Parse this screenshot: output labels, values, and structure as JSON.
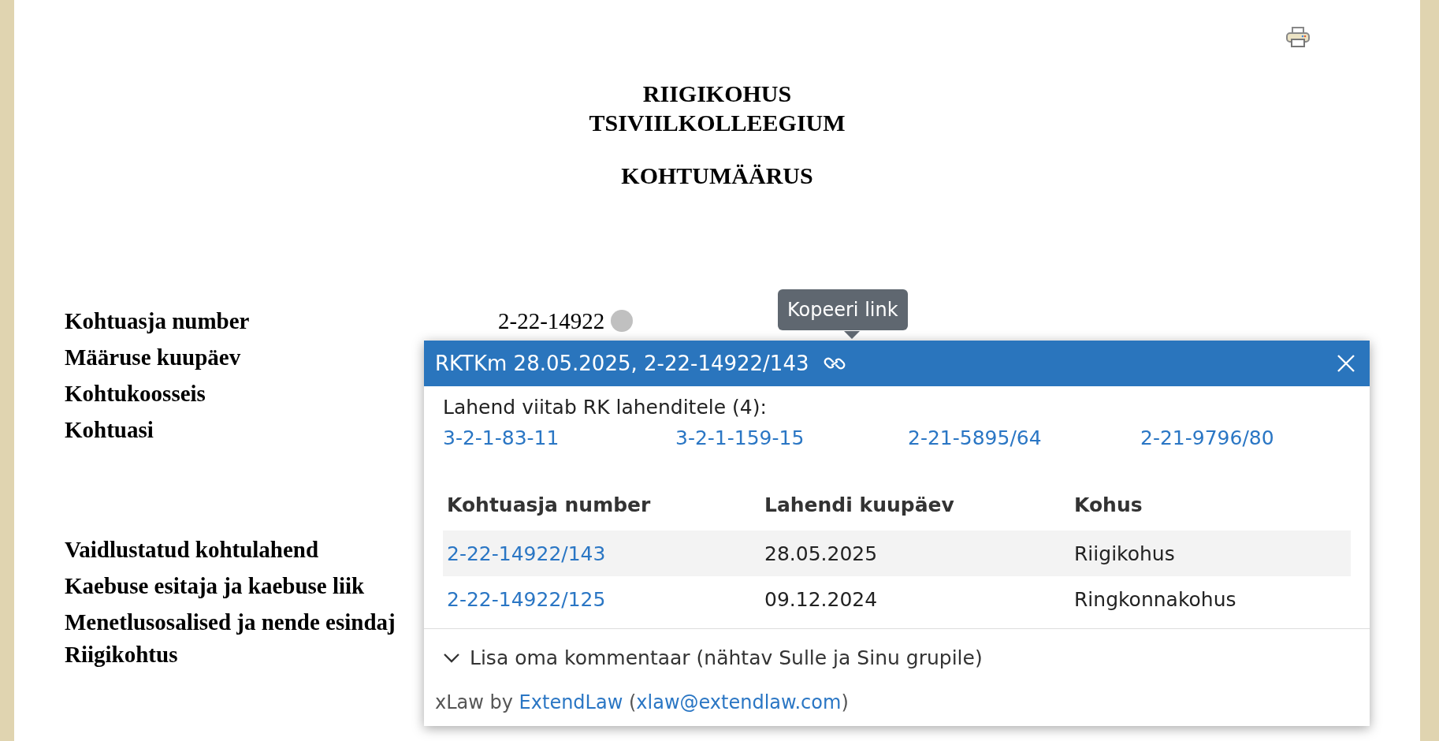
{
  "document": {
    "court": [
      "RIIGIKOHUS",
      "TSIVIILKOLLEEGIUM"
    ],
    "heading": "KOHTUMÄÄRUS",
    "field_groups": [
      [
        {
          "label": "Kohtuasja number",
          "value": "2-22-14922"
        },
        {
          "label": "Määruse kuupäev"
        },
        {
          "label": "Kohtukoosseis"
        },
        {
          "label": "Kohtuasi"
        }
      ],
      [
        {
          "label": "Vaidlustatud kohtulahend"
        },
        {
          "label": "Kaebuse esitaja ja kaebuse liik"
        },
        {
          "label": "Menetlusosalised ja nende esindaj"
        },
        {
          "label": "Riigikohtus"
        }
      ]
    ]
  },
  "tooltip": "Kopeeri link",
  "popup": {
    "title": "RKTKm 28.05.2025, 2-22-14922/143",
    "refs_label": "Lahend viitab RK lahenditele (4):",
    "refs": [
      "3-2-1-83-11",
      "3-2-1-159-15",
      "2-21-5895/64",
      "2-21-9796/80"
    ],
    "table": {
      "columns": [
        "Kohtuasja number",
        "Lahendi kuupäev",
        "Kohus"
      ],
      "rows": [
        {
          "number": "2-22-14922/143",
          "date": "28.05.2025",
          "court": "Riigikohus",
          "highlighted": true
        },
        {
          "number": "2-22-14922/125",
          "date": "09.12.2024",
          "court": "Ringkonnakohus",
          "highlighted": false
        }
      ]
    },
    "comment": {
      "label": "Lisa oma kommentaar (nähtav Sulle ja Sinu grupile)",
      "expanded": false
    },
    "footer": [
      {
        "kind": "text",
        "text": "xLaw by "
      },
      {
        "kind": "link",
        "text": "ExtendLaw"
      },
      {
        "kind": "text",
        "text": " ("
      },
      {
        "kind": "link",
        "text": "xlaw@extendlaw.com"
      },
      {
        "kind": "text",
        "text": ")"
      }
    ]
  }
}
